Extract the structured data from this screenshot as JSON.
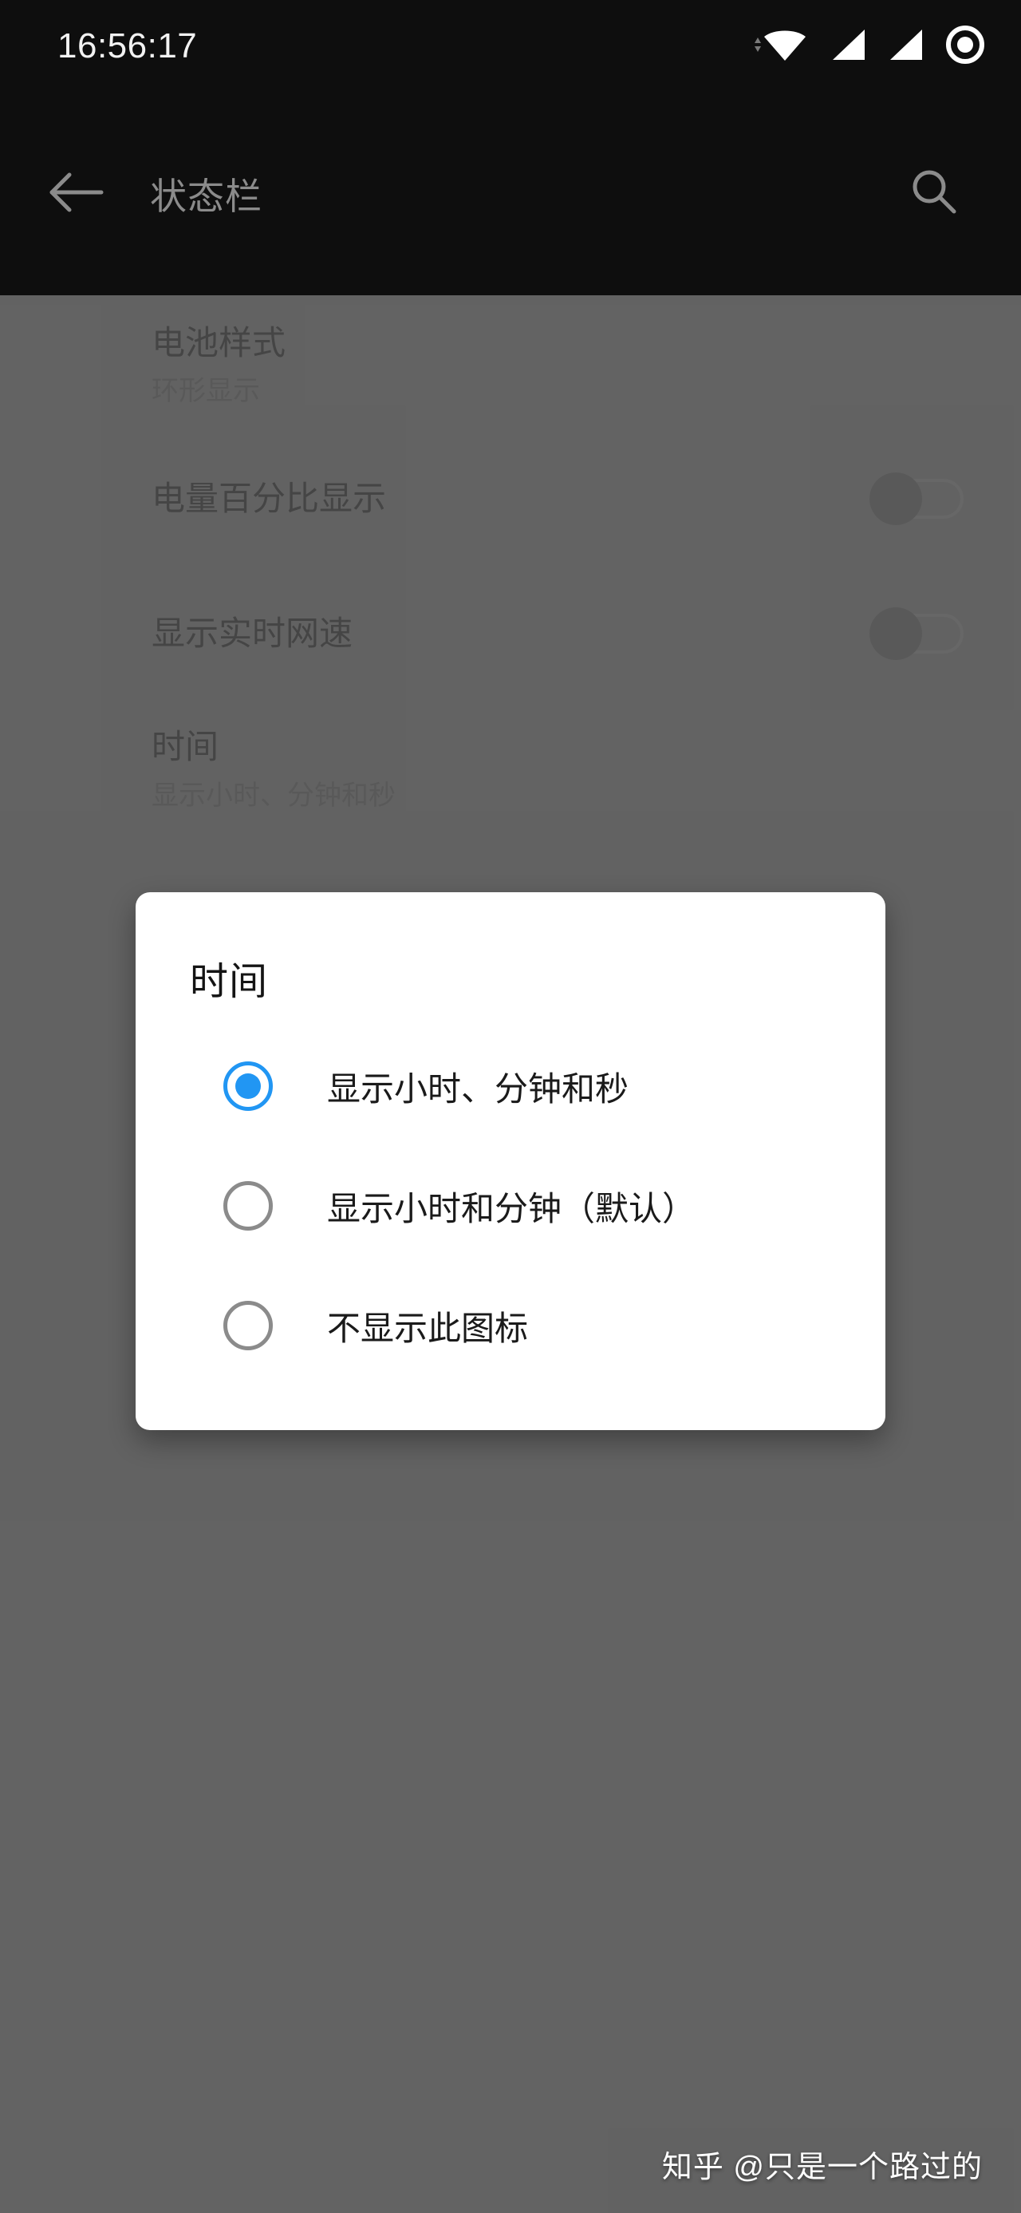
{
  "status_bar": {
    "clock": "16:56:17",
    "icons": [
      {
        "name": "wifi-data-arrows-icon"
      },
      {
        "name": "wifi-icon"
      },
      {
        "name": "signal-sim1-icon"
      },
      {
        "name": "signal-sim2-icon"
      },
      {
        "name": "battery-ring-icon"
      }
    ]
  },
  "app_bar": {
    "title": "状态栏",
    "back_icon": "arrow-left-icon",
    "search_icon": "search-icon"
  },
  "settings": {
    "rows": [
      {
        "title": "电池样式",
        "subtitle": "环形显示",
        "control": "none"
      },
      {
        "title": "电量百分比显示",
        "subtitle": "",
        "control": "switch",
        "switch_on": false
      },
      {
        "title": "显示实时网速",
        "subtitle": "",
        "control": "switch",
        "switch_on": false
      },
      {
        "title": "时间",
        "subtitle": "显示小时、分钟和秒",
        "control": "none"
      }
    ]
  },
  "dialog": {
    "title": "时间",
    "options": [
      {
        "label": "显示小时、分钟和秒",
        "selected": true
      },
      {
        "label": "显示小时和分钟（默认）",
        "selected": false
      },
      {
        "label": "不显示此图标",
        "selected": false
      }
    ]
  },
  "watermark": {
    "text": "知乎 @只是一个路过的"
  },
  "colors": {
    "status_bar_bg": "#0e0e0e",
    "app_bar_bg": "#0e0e0e",
    "app_bar_title": "#8b8b8b",
    "page_bg": "#636363",
    "dialog_bg": "#ffffff",
    "accent": "#2196f3",
    "radio_unselected": "#8b8b8b"
  }
}
